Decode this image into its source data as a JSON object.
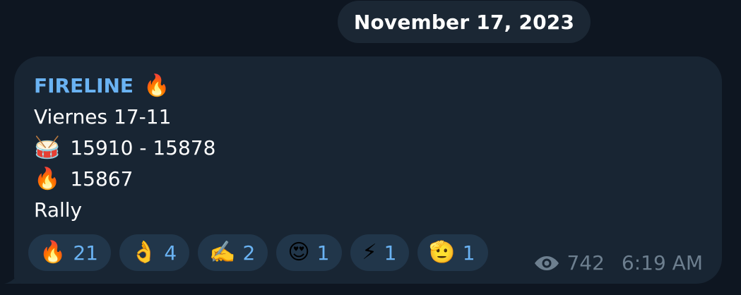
{
  "date_separator": "November 17, 2023",
  "message": {
    "sender": "FIRELINE",
    "sender_emoji": "🔥",
    "lines": [
      {
        "emoji": "",
        "text": "Viernes 17-11"
      },
      {
        "emoji": "🥁",
        "text": "15910 - 15878"
      },
      {
        "emoji": "🔥",
        "text": "15867"
      },
      {
        "emoji": "",
        "text": "Rally"
      }
    ],
    "reactions": [
      {
        "emoji": "🔥",
        "count": "21"
      },
      {
        "emoji": "👌",
        "count": "4"
      },
      {
        "emoji": "✍️",
        "count": "2"
      },
      {
        "emoji": "😍",
        "count": "1"
      },
      {
        "emoji": "⚡",
        "count": "1"
      },
      {
        "emoji": "🫡",
        "count": "1"
      }
    ],
    "views": "742",
    "time": "6:19 AM"
  },
  "colors": {
    "background": "#0e1621",
    "bubble": "#182533",
    "sender": "#6ab3f3",
    "reaction_bg": "#21364a",
    "meta": "#6d7f8f"
  }
}
